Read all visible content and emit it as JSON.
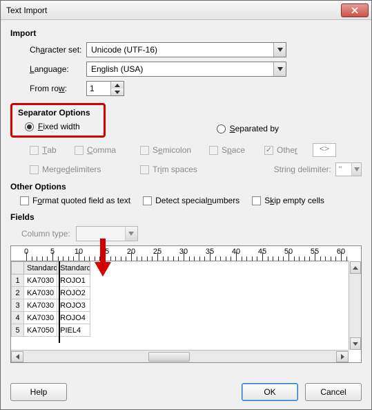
{
  "title": "Text Import",
  "import": {
    "heading": "Import",
    "charset_label": "Character set:",
    "charset_value": "Unicode (UTF-16)",
    "language_label": "Language:",
    "language_value": "English (USA)",
    "fromrow_label": "From row:",
    "fromrow_value": "1"
  },
  "separator": {
    "heading": "Separator Options",
    "fixed_label": "Fixed width",
    "fixed_checked": true,
    "separated_label": "Separated by",
    "separated_checked": false,
    "tab": "Tab",
    "comma": "Comma",
    "semicolon": "Semicolon",
    "space": "Space",
    "other": "Other",
    "other_value": "<>",
    "merge": "Merge delimiters",
    "trim": "Trim spaces",
    "string_delim_label": "String delimiter:",
    "string_delim_value": "\""
  },
  "other": {
    "heading": "Other Options",
    "format_quoted": "Format quoted field as text",
    "detect_special": "Detect special numbers",
    "skip_empty": "Skip empty cells"
  },
  "fields": {
    "heading": "Fields",
    "coltype_label": "Column type:",
    "header1": "Standard",
    "header2": "Standard",
    "rows": [
      {
        "n": "1",
        "a": "KA7030",
        "b": "ROJO1"
      },
      {
        "n": "2",
        "a": "KA7030",
        "b": "ROJO2"
      },
      {
        "n": "3",
        "a": "KA7030",
        "b": "ROJO3"
      },
      {
        "n": "4",
        "a": "KA7030",
        "b": "ROJO4"
      },
      {
        "n": "5",
        "a": "KA7050",
        "b": "PIEL4"
      }
    ],
    "ruler_majors": [
      "0",
      "5",
      "10",
      "15",
      "20",
      "25",
      "30",
      "35",
      "40",
      "45",
      "50",
      "55",
      "60"
    ]
  },
  "buttons": {
    "help": "Help",
    "ok": "OK",
    "cancel": "Cancel"
  }
}
